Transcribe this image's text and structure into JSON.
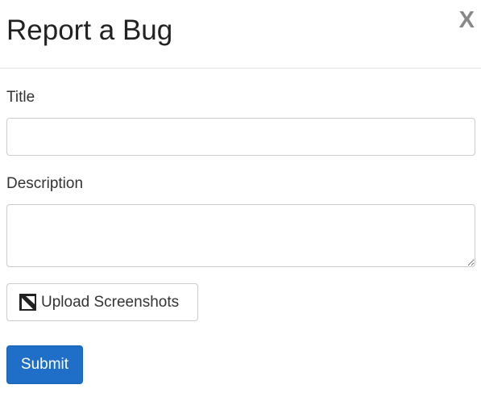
{
  "dialog": {
    "title": "Report a Bug",
    "close_label": "X"
  },
  "form": {
    "title_label": "Title",
    "title_value": "",
    "title_placeholder": "",
    "description_label": "Description",
    "description_value": "",
    "description_placeholder": "",
    "upload_label": "Upload Screenshots",
    "upload_icon": "image-icon",
    "submit_label": "Submit"
  },
  "colors": {
    "primary": "#1f6fc9",
    "border": "#cccccc",
    "close": "#888888",
    "divider": "#e5e5e5"
  }
}
